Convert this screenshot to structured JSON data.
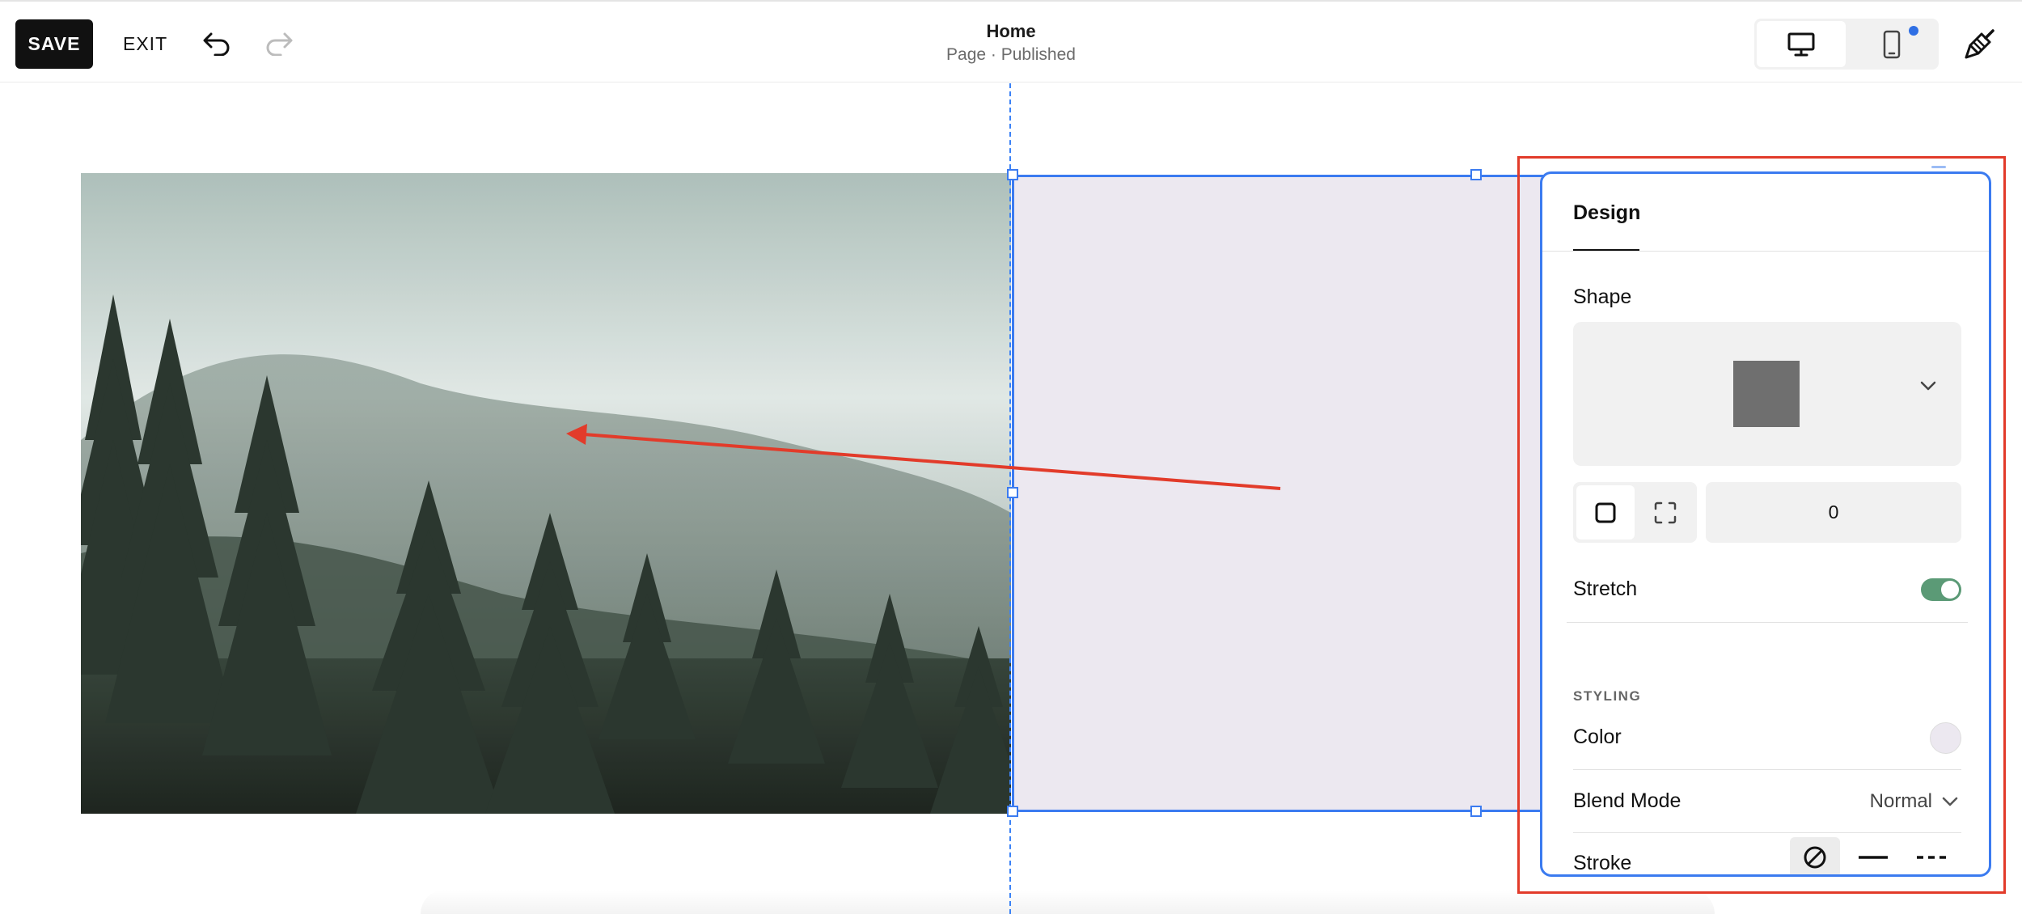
{
  "toolbar": {
    "save_label": "SAVE",
    "exit_label": "EXIT",
    "undo_icon": "undo-icon",
    "redo_icon": "redo-icon"
  },
  "page": {
    "title": "Home",
    "status": "Page · Published"
  },
  "device_toggle": {
    "desktop_icon": "desktop-icon",
    "mobile_icon": "mobile-icon",
    "selected": "desktop"
  },
  "style_icon": "paintbrush-icon",
  "canvas": {
    "image_subject": "misty forest on hillside",
    "shape_fill_color": "#ece8f0",
    "selection_color": "#3b7bf0",
    "annotation_color": "#e23b2a"
  },
  "design_panel": {
    "tab_label": "Design",
    "shape_label": "Shape",
    "shape_preview_color": "#6f6f6f",
    "corner_radius_value": "0",
    "stretch_label": "Stretch",
    "stretch_enabled": true,
    "styling_heading": "STYLING",
    "color_label": "Color",
    "color_value": "#ece8f0",
    "blend_mode_label": "Blend Mode",
    "blend_mode_value": "Normal",
    "stroke_label": "Stroke",
    "stroke_selected": "none"
  },
  "colors": {
    "accent": "#3b7bf0",
    "toggle_on": "#5b9a76",
    "notification_dot": "#2f6fe4",
    "save_bg": "#111111"
  }
}
